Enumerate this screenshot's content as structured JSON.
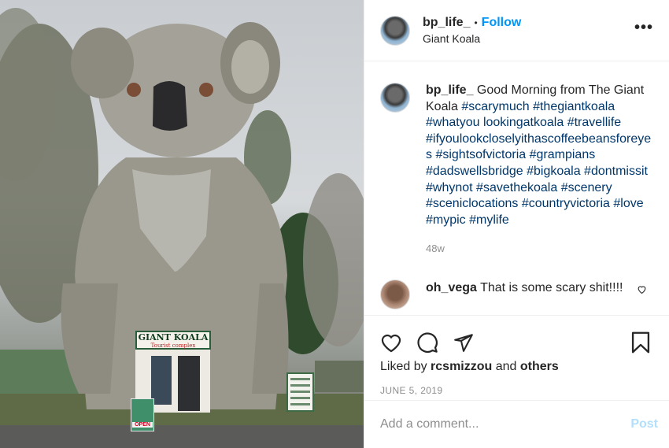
{
  "header": {
    "username": "bp_life_",
    "separator": "•",
    "follow_label": "Follow",
    "location": "Giant Koala",
    "more_label": "•••"
  },
  "photo": {
    "sign_title": "GIANT KOALA",
    "sign_subtitle": "Tourist complex",
    "open_sign": "OPEN"
  },
  "caption": {
    "username": "bp_life_",
    "text": "Good Morning from The Giant Koala",
    "hashtags": [
      "#scarymuch",
      "#thegiantkoala",
      "#whatyou",
      "lookingatkoala",
      "#travellife",
      "#ifyoulookcloselyithascoffeebeansforeyes",
      "#sightsofvictoria",
      "#grampians",
      "#dadswellsbridge",
      "#bigkoala",
      "#dontmissit",
      "#whynot",
      "#savethekoala",
      "#scenery",
      "#sceniclocations",
      "#countryvictoria",
      "#love",
      "#mypic",
      "#mylife"
    ],
    "time": "48w"
  },
  "comment": {
    "username": "oh_vega",
    "text": "That is some scary shit!!!!"
  },
  "likes": {
    "prefix": "Liked by",
    "user": "rcsmizzou",
    "joiner": "and",
    "others": "others"
  },
  "date": "JUNE 5, 2019",
  "add_comment": {
    "placeholder": "Add a comment...",
    "post_label": "Post"
  },
  "colors": {
    "accent": "#0095f6",
    "hashtag": "#00376b",
    "muted": "#8e8e8e",
    "post_disabled": "#b2dffc"
  }
}
